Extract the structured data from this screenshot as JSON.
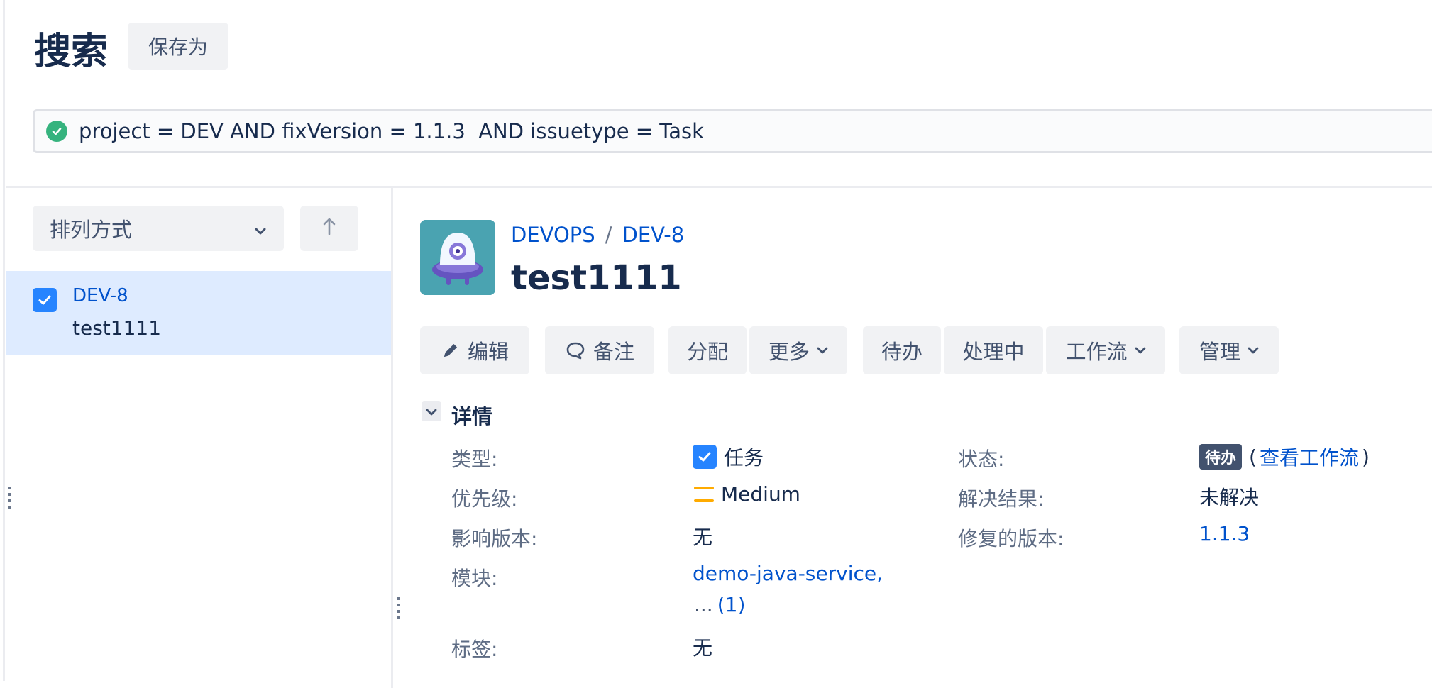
{
  "header": {
    "title": "搜索",
    "save_as_label": "保存为"
  },
  "search": {
    "jql": "project = DEV AND fixVersion = 1.1.3  AND issuetype = Task"
  },
  "sidebar": {
    "sort_label": "排列方式",
    "results": [
      {
        "key": "DEV-8",
        "summary": "test1111"
      }
    ]
  },
  "issue": {
    "breadcrumb": {
      "project": "DEVOPS",
      "separator": "/",
      "key": "DEV-8"
    },
    "summary": "test1111"
  },
  "toolbar": {
    "edit": "编辑",
    "comment": "备注",
    "assign": "分配",
    "more": "更多",
    "todo": "待办",
    "in_progress": "处理中",
    "workflow": "工作流",
    "admin": "管理"
  },
  "details": {
    "section_title": "详情",
    "type_label": "类型:",
    "type_value": "任务",
    "status_label": "状态:",
    "status_value": "待办",
    "view_workflow_open": "(",
    "view_workflow_link": "查看工作流",
    "view_workflow_close": ")",
    "priority_label": "优先级:",
    "priority_value": "Medium",
    "resolution_label": "解决结果:",
    "resolution_value": "未解决",
    "affects_label": "影响版本:",
    "affects_value": "无",
    "fix_version_label": "修复的版本:",
    "fix_version_value": "1.1.3",
    "components_label": "模块:",
    "components_value": "demo-java-service,",
    "components_more_ellipsis": "...",
    "components_more_count": "(1)",
    "labels_label": "标签:",
    "labels_value": "无"
  },
  "colors": {
    "link": "#0052cc",
    "success": "#36b37e",
    "checkbox": "#2684ff",
    "priority_medium": "#ffab00",
    "selected_row": "#deebff"
  },
  "icons": [
    "check-circle-icon",
    "chevron-down-icon",
    "arrow-up-icon",
    "checkbox-icon",
    "pencil-icon",
    "comment-icon",
    "priority-medium-icon"
  ]
}
